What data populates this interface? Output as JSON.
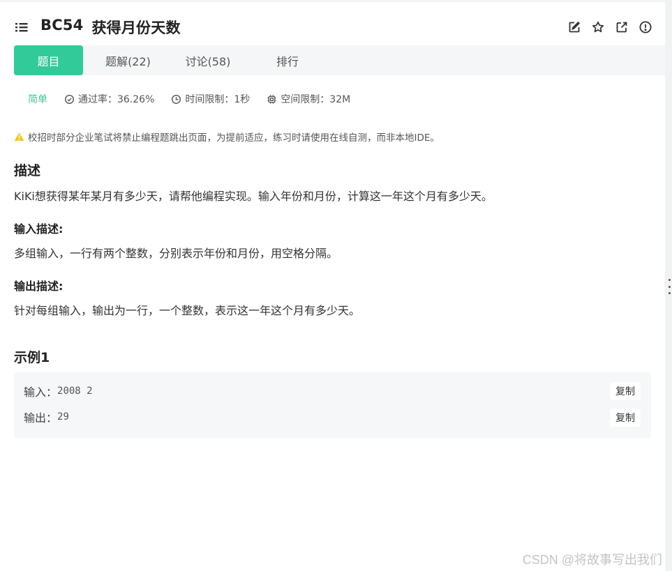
{
  "header": {
    "problem_id": "BC54",
    "problem_title": "获得月份天数",
    "actions": [
      "edit-icon",
      "star-icon",
      "share-icon",
      "report-icon"
    ]
  },
  "tabs": [
    {
      "label": "题目",
      "active": true
    },
    {
      "label": "题解(22)",
      "active": false
    },
    {
      "label": "讨论(58)",
      "active": false
    },
    {
      "label": "排行",
      "active": false
    }
  ],
  "meta": {
    "difficulty": "简单",
    "pass_rate": "通过率：36.26%",
    "time_limit": "时间限制：1秒",
    "space_limit": "空间限制：32M"
  },
  "notice": "校招时部分企业笔试将禁止编程题跳出页面，为提前适应，练习时请使用在线自测，而非本地IDE。",
  "description": {
    "heading": "描述",
    "text": "KiKi想获得某年某月有多少天，请帮他编程实现。输入年份和月份，计算这一年这个月有多少天。"
  },
  "input_desc": {
    "heading": "输入描述:",
    "text": "多组输入，一行有两个整数，分别表示年份和月份，用空格分隔。"
  },
  "output_desc": {
    "heading": "输出描述:",
    "text": "针对每组输入，输出为一行，一个整数，表示这一年这个月有多少天。"
  },
  "example": {
    "heading": "示例1",
    "input_label": "输入：",
    "input_value": "2008 2",
    "output_label": "输出：",
    "output_value": "29",
    "copy_label": "复制"
  },
  "watermark": "CSDN @将故事写出我们",
  "colors": {
    "accent": "#32ca99",
    "warning": "#f5c518"
  }
}
